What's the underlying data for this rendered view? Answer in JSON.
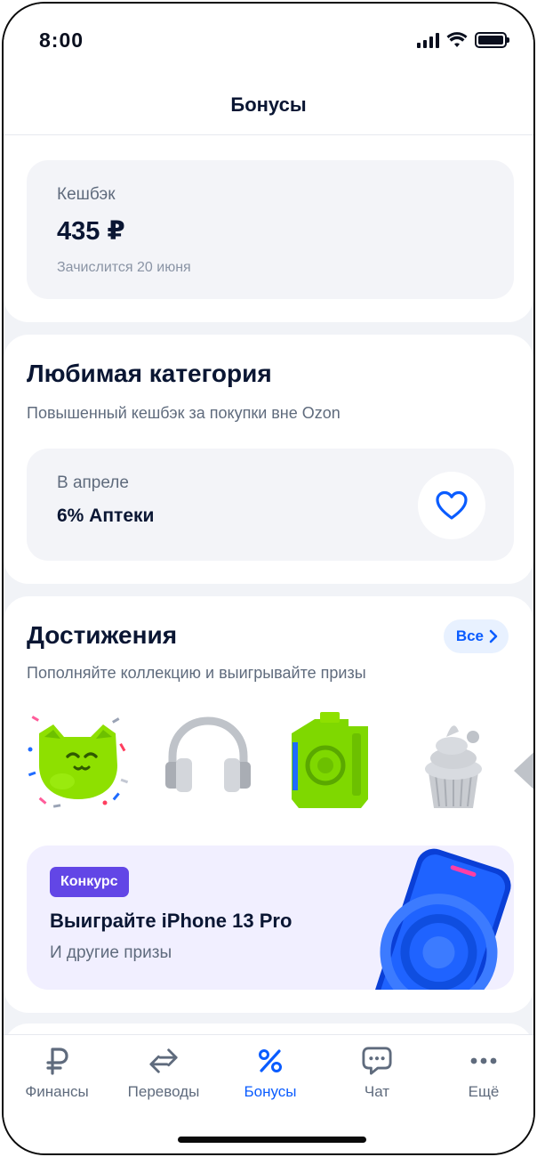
{
  "status_bar": {
    "time": "8:00"
  },
  "header": {
    "title": "Бонусы"
  },
  "cashback": {
    "label": "Кешбэк",
    "amount": "435 ₽",
    "credit_date": "Зачислится 20 июня"
  },
  "favorite_category": {
    "title": "Любимая категория",
    "subtitle": "Повышенный кешбэк за покупки вне Ozon",
    "month": "В апреле",
    "category": "6% Аптеки",
    "icon": "heart-icon"
  },
  "achievements": {
    "title": "Достижения",
    "subtitle": "Пополняйте коллекцию и выигрывайте призы",
    "all_button": "Все",
    "items": [
      {
        "name": "cat-badge"
      },
      {
        "name": "headphones-badge"
      },
      {
        "name": "canister-badge"
      },
      {
        "name": "cupcake-badge"
      }
    ]
  },
  "promo": {
    "badge": "Конкурс",
    "title": "Выиграйте iPhone 13 Pro",
    "subtitle": "И другие призы"
  },
  "tabbar": {
    "items": [
      {
        "label": "Финансы",
        "icon": "ruble-icon",
        "active": false
      },
      {
        "label": "Переводы",
        "icon": "transfer-arrows-icon",
        "active": false
      },
      {
        "label": "Бонусы",
        "icon": "percent-icon",
        "active": true
      },
      {
        "label": "Чат",
        "icon": "chat-icon",
        "active": false
      },
      {
        "label": "Ещё",
        "icon": "more-icon",
        "active": false
      }
    ]
  },
  "colors": {
    "accent": "#0a5cff",
    "text_primary": "#0a1633",
    "text_secondary": "#5f6b7d",
    "badge": "#6246e6"
  }
}
